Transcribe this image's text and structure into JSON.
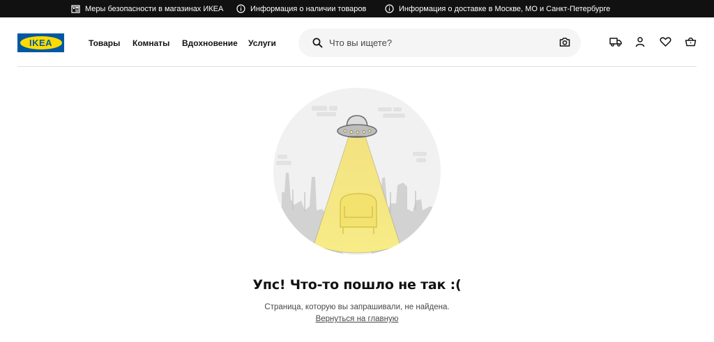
{
  "topbar": {
    "items": [
      {
        "label": "Меры безопасности в магазинах ИКЕА",
        "icon": "store-icon"
      },
      {
        "label": "Информация о наличии товаров",
        "icon": "info-icon"
      },
      {
        "label": "Информация о доставке в Москве, МО и Санкт-Петербурге",
        "icon": "info-icon"
      }
    ]
  },
  "header": {
    "logo_text": "IKEA",
    "nav": [
      "Товары",
      "Комнаты",
      "Вдохновение",
      "Услуги"
    ],
    "search": {
      "placeholder": "Что вы ищете?"
    },
    "icons": [
      "truck-icon",
      "user-icon",
      "heart-icon",
      "bag-icon"
    ]
  },
  "error": {
    "title": "Упс! Что-то пошло не так :(",
    "message": "Страница, которую вы запрашивали, не найдена.",
    "link": "Вернуться на главную"
  },
  "colors": {
    "topbar_bg": "#111111",
    "ikea_blue": "#0058a3",
    "ikea_yellow": "#ffdb00",
    "beam_yellow": "#f7ea7d"
  }
}
